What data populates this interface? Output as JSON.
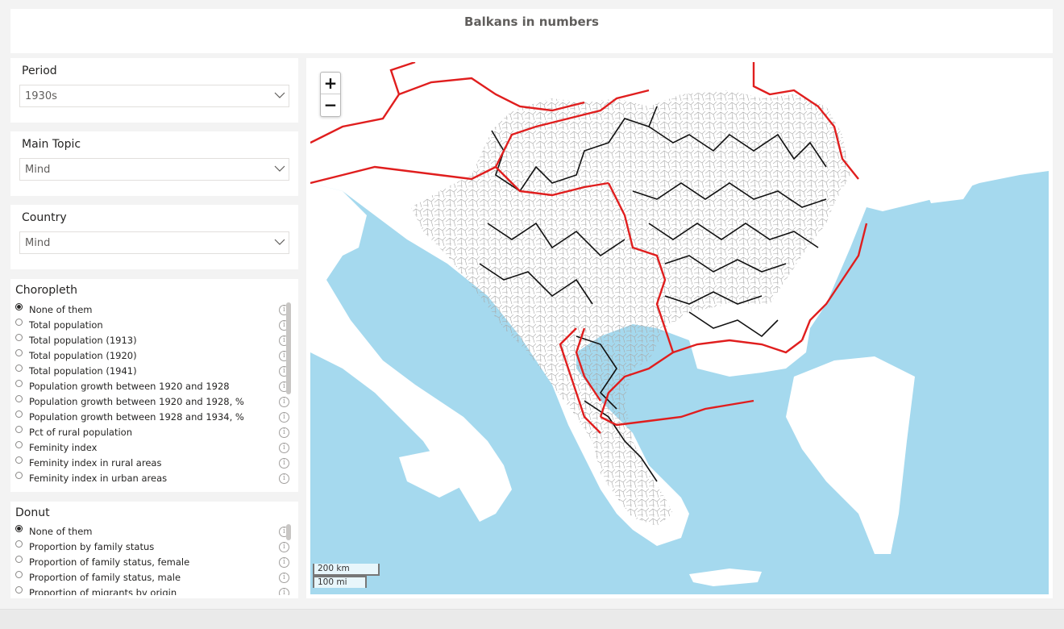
{
  "report": {
    "title": "Balkans in numbers"
  },
  "period": {
    "label": "Period",
    "value": "1930s"
  },
  "main_topic": {
    "label": "Main Topic",
    "value": "Mind"
  },
  "country": {
    "label": "Country",
    "value": "Mind"
  },
  "choropleth": {
    "heading": "Choropleth",
    "items": [
      "None of them",
      "Total population",
      "Total population (1913)",
      "Total population (1920)",
      "Total population (1941)",
      "Population growth between 1920 and 1928",
      "Population growth between 1920 and 1928, %",
      "Population growth between 1928 and 1934, %",
      "Pct of rural population",
      "Feminity index",
      "Feminity index in rural areas",
      "Feminity index in urban areas"
    ],
    "selected_index": 0
  },
  "donut": {
    "heading": "Donut",
    "items": [
      "None of them",
      "Proportion by family status",
      "Proportion of family status, female",
      "Proportion of family status, male",
      "Proportion of migrants by origin"
    ],
    "selected_index": 0
  },
  "map": {
    "zoom_in": "+",
    "zoom_out": "−",
    "scale_km": "200 km",
    "scale_mi": "100 mi",
    "colors": {
      "sea": "#a5d9ee",
      "land": "#ffffff",
      "border_country": "#e01e1e",
      "border_region": "#111111",
      "border_district": "#9a9a9a"
    }
  },
  "icons": {
    "info": "info-icon",
    "dropdown": "chevron-down-icon"
  }
}
